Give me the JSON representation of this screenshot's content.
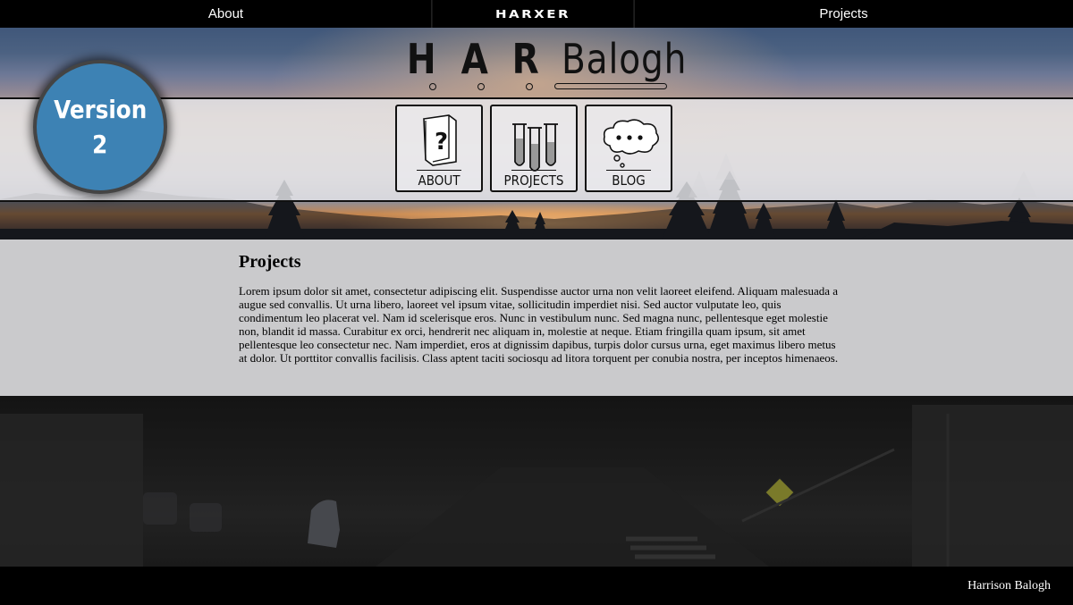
{
  "nav": {
    "about": "About",
    "brand": "HARXER",
    "projects": "Projects"
  },
  "logo": {
    "initials": [
      "H",
      "A",
      "R"
    ],
    "surname": "Balogh"
  },
  "badge": {
    "line1": "Version",
    "line2": "2"
  },
  "cards": [
    {
      "label": "ABOUT",
      "icon": "book-question-icon"
    },
    {
      "label": "PROJECTS",
      "icon": "test-tubes-icon"
    },
    {
      "label": "BLOG",
      "icon": "thought-bubble-icon"
    }
  ],
  "content": {
    "heading": "Projects",
    "body": "Lorem ipsum dolor sit amet, consectetur adipiscing elit. Suspendisse auctor urna non velit laoreet eleifend. Aliquam malesuada a augue sed convallis. Ut urna libero, laoreet vel ipsum vitae, sollicitudin imperdiet nisi. Sed auctor vulputate leo, quis condimentum leo placerat vel. Nam id scelerisque eros. Nunc in vestibulum nunc. Sed magna nunc, pellentesque eget molestie non, blandit id massa. Curabitur ex orci, hendrerit nec aliquam in, molestie at neque. Etiam fringilla quam ipsum, sit amet pellentesque leo consectetur nec. Nam imperdiet, eros at dignissim dapibus, turpis dolor cursus urna, eget maximus libero metus at dolor. Ut porttitor convallis facilisis. Class aptent taciti sociosqu ad litora torquent per conubia nostra, per inceptos himenaeos."
  },
  "footer": {
    "credit": "Harrison Balogh"
  },
  "colors": {
    "badge": "#3d82b4",
    "nav_bg": "#000000",
    "content_bg": "#d2d2d4"
  }
}
